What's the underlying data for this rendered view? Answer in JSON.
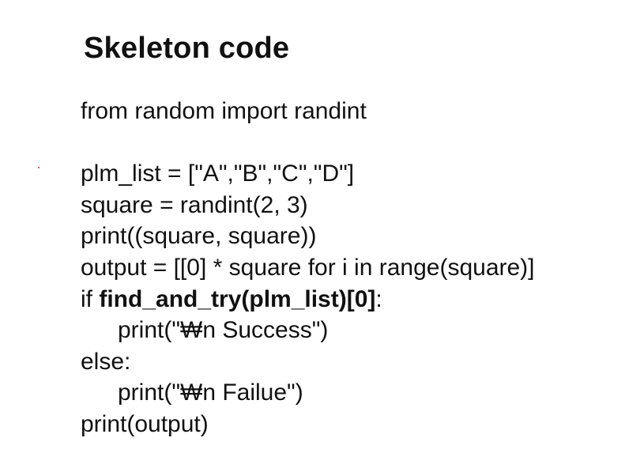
{
  "title": "Skeleton code",
  "code": {
    "line1": "from random import randint",
    "line2": "plm_list = [\"A\",\"B\",\"C\",\"D\"]",
    "line3": "square = randint(2, 3)",
    "line4": "print((square, square))",
    "line5": "output = [[0] * square for i in range(square)]",
    "line6_prefix": "if ",
    "line6_bold": "find_and_try(plm_list)[0]",
    "line6_suffix": ":",
    "line7": "print(\"₩n Success\")",
    "line8": "else:",
    "line9": "print(\"₩n Failue\")",
    "line10": "print(output)"
  }
}
